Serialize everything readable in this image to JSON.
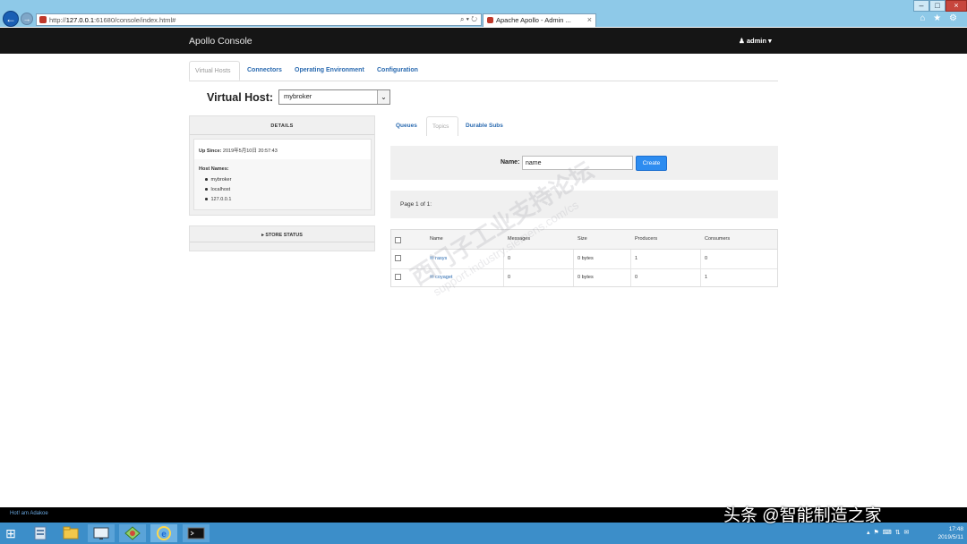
{
  "browser": {
    "url_prefix": "http://",
    "url_host": "127.0.0.1",
    "url_rest": ":61680/console/index.html#",
    "addr_tools": "⌕ ▾ ↻",
    "tab_title": "Apache Apollo - Admin ...",
    "tab_close": "×",
    "win_min": "–",
    "win_max": "□",
    "win_close": "×",
    "icons": "⌂ ★ ⚙"
  },
  "navbar": {
    "brand": "Apollo Console",
    "user": "admin"
  },
  "main_tabs": [
    {
      "label": "Virtual Hosts"
    },
    {
      "label": "Connectors"
    },
    {
      "label": "Operating Environment"
    },
    {
      "label": "Configuration"
    }
  ],
  "virtual_host": {
    "label": "Virtual Host:",
    "selected": "mybroker"
  },
  "details": {
    "title": "DETAILS",
    "up_since_label": "Up Since:",
    "up_since_value": "2019年5月10日 20:57:43",
    "host_names_label": "Host Names:",
    "host_names": [
      "mybroker",
      "localhost",
      "127.0.0.1"
    ]
  },
  "store_status": {
    "title": "▸ STORE STATUS"
  },
  "sub_tabs": [
    {
      "label": "Queues"
    },
    {
      "label": "Topics"
    },
    {
      "label": "Durable Subs"
    }
  ],
  "create_form": {
    "name_label": "Name:",
    "name_value": "name",
    "create_label": "Create"
  },
  "pagination": {
    "text": "Page 1 of 1:"
  },
  "table": {
    "headers": [
      "Name",
      "Messages",
      "Size",
      "Producers",
      "Consumers"
    ],
    "rows": [
      {
        "name": "✉ rasys",
        "messages": "0",
        "size": "0 bytes",
        "producers": "1",
        "consumers": "0"
      },
      {
        "name": "✉ coyaget",
        "messages": "0",
        "size": "0 bytes",
        "producers": "0",
        "consumers": "1"
      }
    ]
  },
  "watermark": {
    "line1": "西门子工业支持论坛",
    "line2": "support.industry.siemens.com/cs"
  },
  "status_bar": {
    "left_text": "Hot! am Adakoe"
  },
  "overlay": {
    "text": "头条 @智能制造之家"
  },
  "taskbar": {
    "time": "17:48",
    "date": "2019/5/11",
    "tray_icons": "▴ ⚑ ⌨ ⇅ ✉"
  },
  "colors": {
    "link": "#2a6ab0",
    "navbar": "#151515",
    "create_button": "#2d8cf0",
    "taskbar": "#3c8ec9",
    "chrome": "#8ec9e8"
  }
}
